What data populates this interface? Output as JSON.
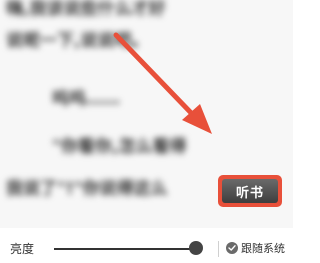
{
  "reader": {
    "lines": [
      "嗨,我该说些什么才好",
      "说呢一下,说说吧。",
      "呜呜……",
      "\"你看你,怎么看得",
      "我说了\"!\"你说得这么"
    ]
  },
  "listen_button": {
    "label": "听书"
  },
  "bottom_bar": {
    "brightness_label": "亮度",
    "brightness_level": 0.97,
    "follow_system_label": "跟随系统",
    "follow_system_checked": true
  },
  "colors": {
    "annotation_red": "#e8503a",
    "button_dark": "#4a4a4a",
    "slider": "#333333"
  }
}
